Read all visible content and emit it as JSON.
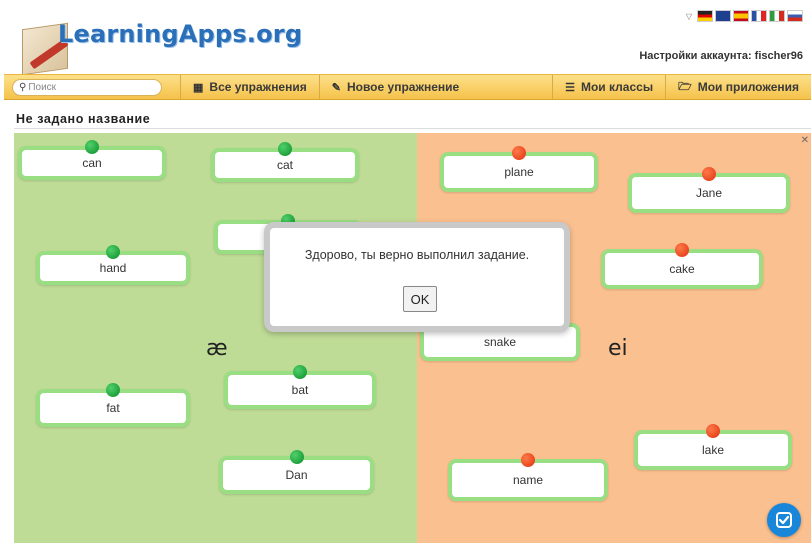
{
  "logo": {
    "text": "LearningApps.org"
  },
  "account": {
    "text": "Настройки аккаунта: fischer96"
  },
  "flags": [
    {
      "name": "flag-de",
      "color": "#222222"
    },
    {
      "name": "flag-uk",
      "color": "#1f3f8f"
    },
    {
      "name": "flag-es",
      "color": "#d52b1e"
    },
    {
      "name": "flag-fr",
      "color": "#2b4fa3"
    },
    {
      "name": "flag-it",
      "color": "#2e9b3f"
    },
    {
      "name": "flag-ru",
      "color": "#3a5fb0"
    }
  ],
  "nav": {
    "search_placeholder": "Поиск",
    "all_exercises": "Все упражнения",
    "new_exercise": "Новое упражнение",
    "my_classes": "Мои классы",
    "my_apps": "Мои приложения"
  },
  "page": {
    "title": "Не задано название"
  },
  "zones": {
    "left_label": "æ",
    "right_label": "ei",
    "left_color": "#bfdc96",
    "right_color": "#fbc08f"
  },
  "cards_left": [
    "can",
    "cat",
    "hand",
    "bat",
    "fat",
    "Dan"
  ],
  "cards_right": [
    "plane",
    "Jane",
    "cake",
    "snake",
    "lake",
    "name"
  ],
  "modal": {
    "message": "Здорово, ты верно выполнил задание.",
    "ok": "OK"
  },
  "icons": {
    "search": "search-icon",
    "grid": "grid-icon",
    "pencil": "pencil-icon",
    "list": "list-icon",
    "folder": "folder-icon",
    "check": "check-icon"
  }
}
